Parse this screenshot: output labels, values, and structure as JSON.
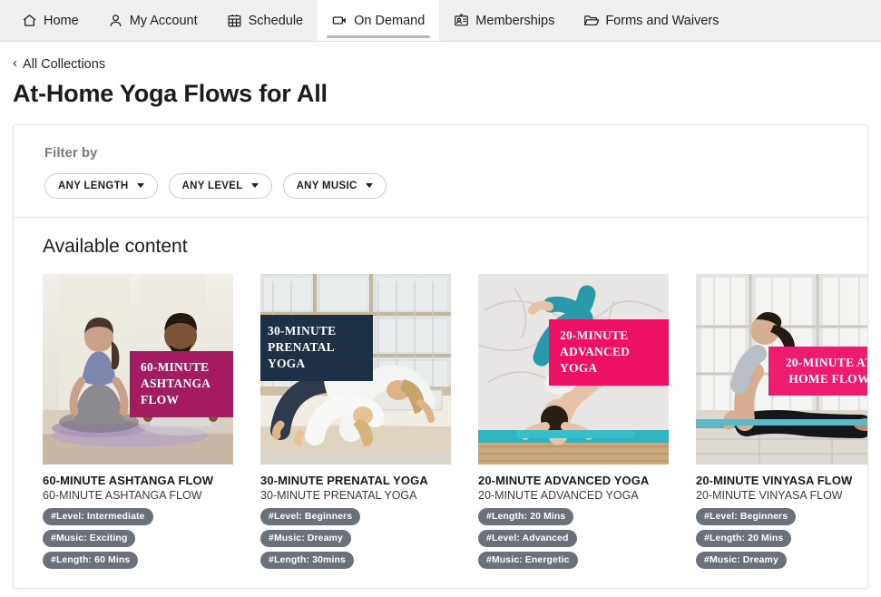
{
  "nav": {
    "items": [
      {
        "label": "Home",
        "icon": "home-icon",
        "active": false
      },
      {
        "label": "My Account",
        "icon": "user-icon",
        "active": false
      },
      {
        "label": "Schedule",
        "icon": "calendar-icon",
        "active": false
      },
      {
        "label": "On Demand",
        "icon": "video-icon",
        "active": true
      },
      {
        "label": "Memberships",
        "icon": "id-card-icon",
        "active": false
      },
      {
        "label": "Forms and Waivers",
        "icon": "folder-icon",
        "active": false
      }
    ]
  },
  "breadcrumb": {
    "label": "All Collections",
    "chevron": "‹"
  },
  "page_title": "At-Home Yoga Flows for All",
  "filter": {
    "heading": "Filter by",
    "chips": [
      {
        "label": "ANY LENGTH"
      },
      {
        "label": "ANY LEVEL"
      },
      {
        "label": "ANY MUSIC"
      }
    ]
  },
  "content": {
    "heading": "Available content",
    "cards": [
      {
        "ribbon_lines": [
          "60-MINUTE",
          "ASHTANGA FLOW"
        ],
        "ribbon_color": "#a41b62",
        "ribbon_pos": "right-mid",
        "ribbon_align": "left",
        "title": "60-MINUTE ASHTANGA FLOW",
        "subtitle": "60-MINUTE ASHTANGA FLOW",
        "tags": [
          "#Level: Intermediate",
          "#Music: Exciting",
          "#Length: 60 Mins"
        ],
        "scene": "two-seated-meditation"
      },
      {
        "ribbon_lines": [
          "30-MINUTE",
          "PRENATAL YOGA"
        ],
        "ribbon_color": "#1e3046",
        "ribbon_pos": "left-top",
        "ribbon_align": "left",
        "title": "30-MINUTE PRENATAL YOGA",
        "subtitle": "30-MINUTE PRENATAL YOGA",
        "tags": [
          "#Level: Beginners",
          "#Music: Dreamy",
          "#Length: 30mins"
        ],
        "scene": "downward-dog-pair"
      },
      {
        "ribbon_lines": [
          "20-MINUTE",
          "ADVANCED YOGA"
        ],
        "ribbon_color": "#ed1164",
        "ribbon_pos": "right-upper",
        "ribbon_align": "left",
        "title": "20-MINUTE ADVANCED YOGA",
        "subtitle": "20-MINUTE ADVANCED YOGA",
        "tags": [
          "#Length: 20 Mins",
          "#Level: Advanced",
          "#Music: Energetic"
        ],
        "scene": "forearm-stand"
      },
      {
        "ribbon_lines": [
          "20-MINUTE AT",
          "HOME FLOW"
        ],
        "ribbon_color": "#ee1c6e",
        "ribbon_pos": "right-mid2",
        "ribbon_align": "center",
        "title": "20-MINUTE VINYASA FLOW",
        "subtitle": "20-MINUTE VINYASA FLOW",
        "tags": [
          "#Level: Beginners",
          "#Length: 20 Mins",
          "#Music: Dreamy"
        ],
        "scene": "upward-dog"
      }
    ]
  },
  "colors": {
    "nav_bg": "#f0f0f0",
    "tag_bg": "#6b717a",
    "active_underline": "#b8b8b8"
  }
}
